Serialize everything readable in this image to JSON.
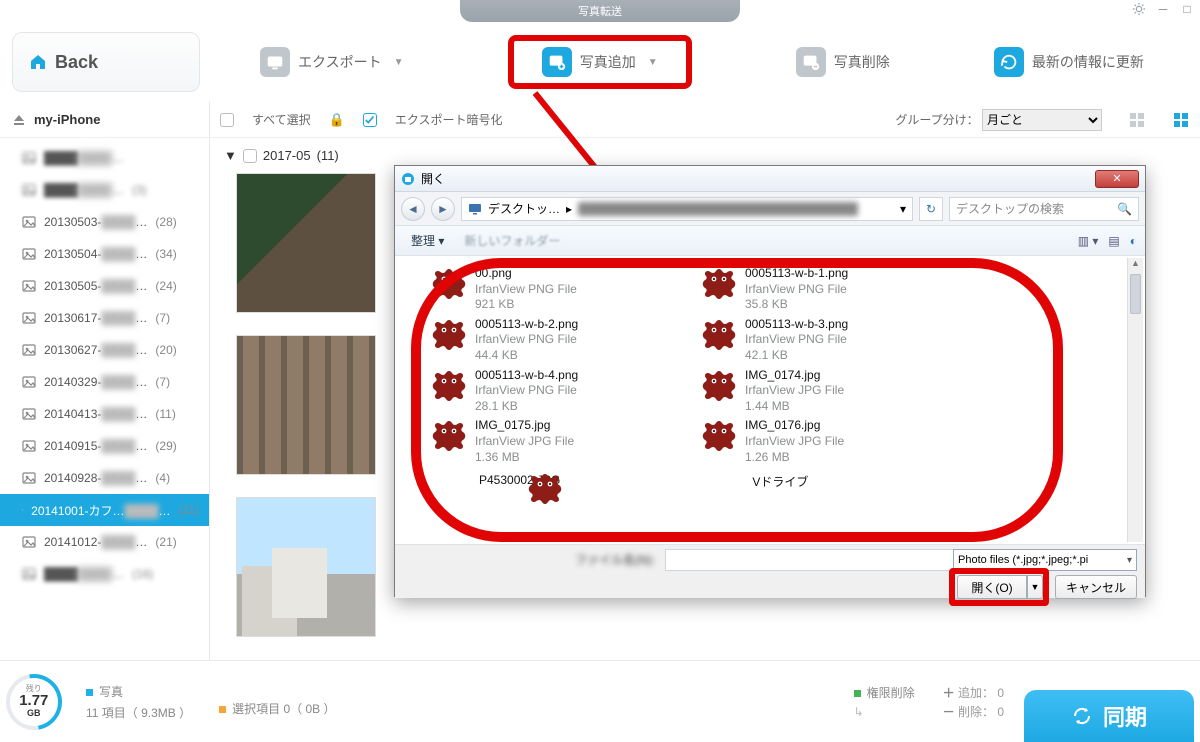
{
  "window": {
    "title": "写真転送",
    "back": "Back"
  },
  "toolbar": {
    "export": "エクスポート",
    "add": "写真追加",
    "delete": "写真削除",
    "refresh": "最新の情報に更新"
  },
  "subbar": {
    "select_all": "すべて選択",
    "encrypt": "エクスポート暗号化",
    "group_label": "グループ分け：",
    "group_value": "月ごと"
  },
  "sidebar": {
    "device": "my-iPhone",
    "items": [
      {
        "label": "",
        "count": ""
      },
      {
        "label": "",
        "count": "(3)"
      },
      {
        "label": "20130503-",
        "count": "(28)"
      },
      {
        "label": "20130504-",
        "count": "(34)"
      },
      {
        "label": "20130505-",
        "count": "(24)"
      },
      {
        "label": "20130617-",
        "count": "(7)"
      },
      {
        "label": "20130627-",
        "count": "(20)"
      },
      {
        "label": "20140329-",
        "count": "(7)"
      },
      {
        "label": "20140413-",
        "count": "(11)"
      },
      {
        "label": "20140915-",
        "count": "(29)"
      },
      {
        "label": "20140928-",
        "count": "(4)"
      },
      {
        "label": "20141001-カフ…",
        "count": "(11)",
        "active": true
      },
      {
        "label": "20141012-",
        "count": "(21)"
      },
      {
        "label": "",
        "count": "(16)"
      }
    ]
  },
  "group": {
    "title": "2017-05",
    "count": "(11)"
  },
  "status": {
    "ring_top": "残り",
    "ring_val": "1.77",
    "ring_unit": "GB",
    "photos_label": "写真",
    "items": "11 項目（ 9.3MB ）",
    "selection": "選択項目 0（ 0B ）",
    "perm": "権限削除",
    "add": "追加：",
    "del": "削除：",
    "zero": "0",
    "sync": "同期"
  },
  "dialog": {
    "title": "開く",
    "addr_seg": "デスクトッ…",
    "search_placeholder": "デスクトップの検索",
    "organize": "整理",
    "newfolder": "新しいフォルダー",
    "files": [
      {
        "name": "00.png",
        "type": "IrfanView PNG File",
        "size": "921 KB"
      },
      {
        "name": "0005113-w-b-1.png",
        "type": "IrfanView PNG File",
        "size": "35.8 KB"
      },
      {
        "name": "0005113-w-b-2.png",
        "type": "IrfanView PNG File",
        "size": "44.4 KB"
      },
      {
        "name": "0005113-w-b-3.png",
        "type": "IrfanView PNG File",
        "size": "42.1 KB"
      },
      {
        "name": "0005113-w-b-4.png",
        "type": "IrfanView PNG File",
        "size": "28.1 KB"
      },
      {
        "name": "IMG_0174.jpg",
        "type": "IrfanView JPG File",
        "size": "1.44 MB"
      },
      {
        "name": "IMG_0175.jpg",
        "type": "IrfanView JPG File",
        "size": "1.36 MB"
      },
      {
        "name": "IMG_0176.jpg",
        "type": "IrfanView JPG File",
        "size": "1.26 MB"
      }
    ],
    "extra_left": "P4530002.JPG",
    "extra_right": "Vドライブ",
    "filename_label": "ファイル名(N):",
    "typefilter": "Photo files (*.jpg;*.jpeg;*.pi",
    "open": "開く(O)",
    "cancel": "キャンセル"
  }
}
